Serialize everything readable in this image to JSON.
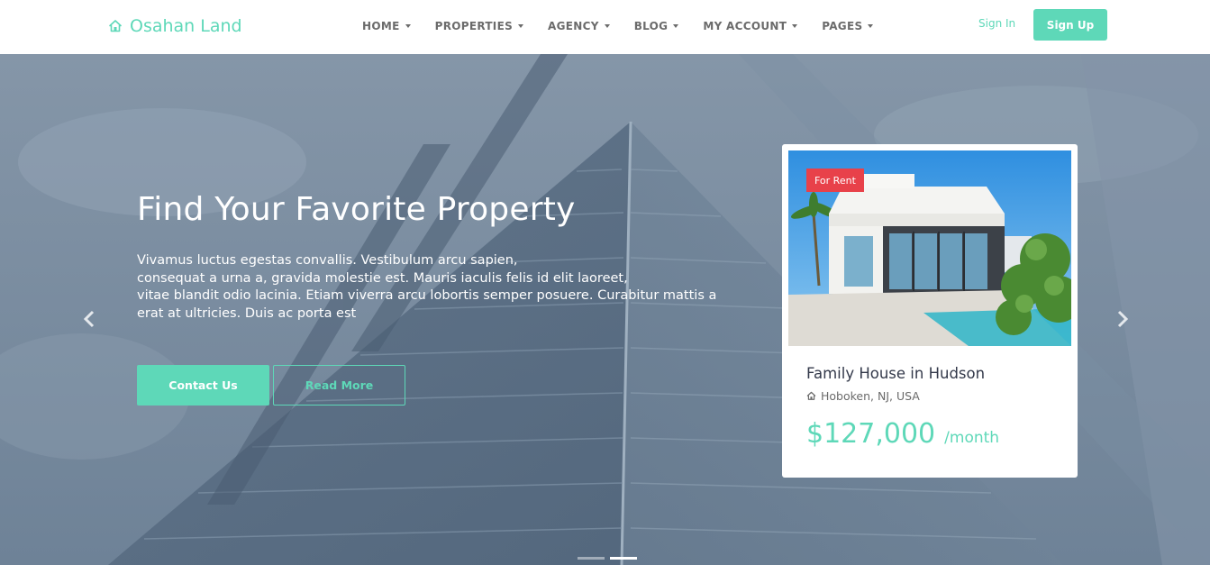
{
  "brand": {
    "name": "Osahan Land",
    "icon": "home-icon",
    "color": "#5ed8b8"
  },
  "nav": {
    "items": [
      {
        "label": "HOME"
      },
      {
        "label": "PROPERTIES"
      },
      {
        "label": "AGENCY"
      },
      {
        "label": "BLOG"
      },
      {
        "label": "MY ACCOUNT"
      },
      {
        "label": "PAGES"
      }
    ],
    "sign_in": "Sign In",
    "sign_up": "Sign Up"
  },
  "hero": {
    "title": "Find Your Favorite Property",
    "description_lines": [
      "Vivamus luctus egestas convallis. Vestibulum arcu sapien,",
      "consequat a urna a, gravida molestie est. Mauris iaculis felis id elit laoreet,",
      "vitae blandit odio lacinia. Etiam viverra arcu lobortis semper posuere. Curabitur mattis a",
      "erat at ultricies. Duis ac porta est"
    ],
    "contact_label": "Contact Us",
    "read_more_label": "Read More",
    "prev_icon": "chevron-left-icon",
    "next_icon": "chevron-right-icon"
  },
  "card": {
    "badge": "For Rent",
    "badge_color": "#e8414a",
    "title": "Family House in Hudson",
    "location": "Hoboken, NJ, USA",
    "location_icon": "home-icon",
    "price": "$127,000",
    "price_unit": "/month"
  },
  "carousel": {
    "slide_count": 2,
    "active_index": 1
  }
}
